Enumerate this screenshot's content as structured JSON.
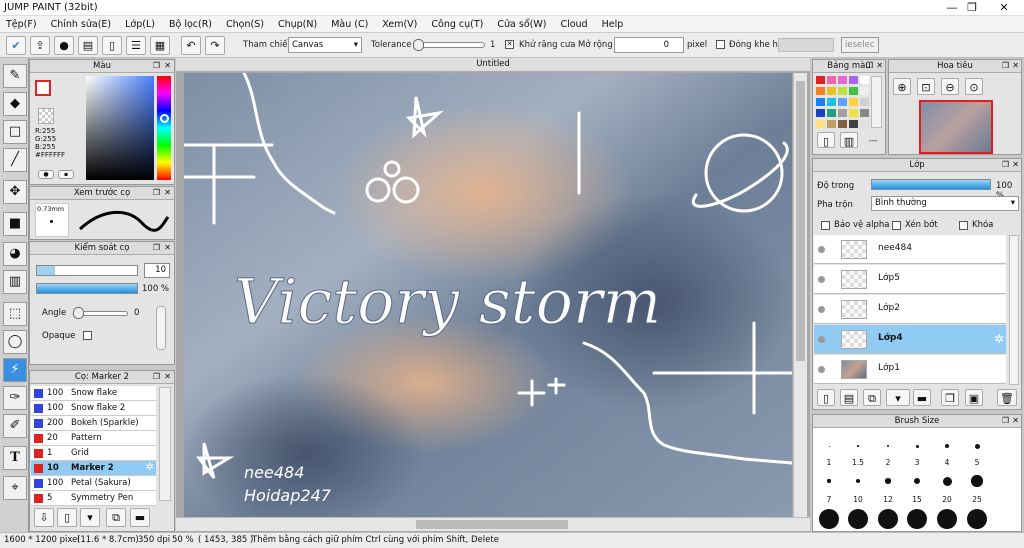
{
  "app": {
    "title": "JUMP PAINT (32bit)"
  },
  "window_controls": {
    "min": "—",
    "max": "❐",
    "close": "✕"
  },
  "menu": [
    "Tệp(F)",
    "Chỉnh sửa(E)",
    "Lớp(L)",
    "Bộ lọc(R)",
    "Chọn(S)",
    "Chụp(N)",
    "Màu (C)",
    "Xem(V)",
    "Công cụ(T)",
    "Cửa sổ(W)",
    "Cloud",
    "Help"
  ],
  "toolbar": {
    "ref_label": "Tham chiếu",
    "ref_value": "Canvas",
    "tolerance_label": "Tolerance",
    "tolerance_value": "1",
    "antialias_label": "Khử răng cưa",
    "expand_label": "Mở rộng",
    "expand_value": "0",
    "pixel_label": "pixel",
    "close_gap_label": "Đóng khe hở",
    "deselect_label": "ieselec"
  },
  "color_panel": {
    "title": "Màu",
    "rgb": "R:255\nG:255\nB:255\n#FFFFFF"
  },
  "brush_preview": {
    "title": "Xem trước cọ",
    "size": "0.73mm"
  },
  "brush_control": {
    "title": "Kiểm soát cọ",
    "size_value": "10",
    "opacity_value": "100 %",
    "angle_label": "Angle",
    "angle_value": "0",
    "opaque_label": "Opaque"
  },
  "brush_list": {
    "title": "Cọ: Marker 2",
    "items": [
      {
        "n": "100",
        "name": "Snow flake",
        "color": "#3344dd"
      },
      {
        "n": "100",
        "name": "Snow flake 2",
        "color": "#3344dd"
      },
      {
        "n": "200",
        "name": "Bokeh (Sparkle)",
        "color": "#3344dd"
      },
      {
        "n": "20",
        "name": "Pattern",
        "color": "#dd2222"
      },
      {
        "n": "1",
        "name": "Grid",
        "color": "#dd2222"
      },
      {
        "n": "10",
        "name": "Marker 2",
        "color": "#dd2222"
      },
      {
        "n": "100",
        "name": "Petal (Sakura)",
        "color": "#3344dd"
      },
      {
        "n": "5",
        "name": "Symmetry Pen",
        "color": "#dd2222"
      }
    ]
  },
  "canvas": {
    "tab": "Untitled",
    "artwork_title": "Victory storm",
    "credit1": "nee484",
    "credit2": "Hoidap247"
  },
  "palette": {
    "title": "Bảng màu",
    "colors": [
      "#e02020",
      "#ee66aa",
      "#e06ad0",
      "#aa66ee",
      "#ffffff",
      "#f08020",
      "#f0c020",
      "#c0e040",
      "#40c040",
      "#eeeeee",
      "#2080f0",
      "#20c0e0",
      "#60a0ff",
      "#ffd040",
      "#d0d0d0",
      "#1a40c0",
      "#20a080",
      "#a0a0a0",
      "#f0e040",
      "#888888",
      "#ffe080",
      "#c0a060",
      "#806040",
      "#404040",
      "#e0e0e0"
    ]
  },
  "navigator": {
    "title": "Hoa tiêu"
  },
  "layers": {
    "title": "Lớp",
    "opacity_label": "Độ trong",
    "opacity_value": "100 %",
    "blend_label": "Pha trộn",
    "blend_value": "Bình thường",
    "protect_alpha": "Bảo vệ alpha",
    "clip": "Xén bớt",
    "lock": "Khóa",
    "items": [
      {
        "name": "nee484",
        "active": false,
        "photo": false
      },
      {
        "name": "Lớp5",
        "active": false,
        "photo": false
      },
      {
        "name": "Lớp2",
        "active": false,
        "photo": false
      },
      {
        "name": "Lớp4",
        "active": true,
        "photo": false
      },
      {
        "name": "Lớp1",
        "active": false,
        "photo": true
      }
    ]
  },
  "brush_size": {
    "title": "Brush Size",
    "row1": [
      "1",
      "1.5",
      "2",
      "3",
      "4",
      "5"
    ],
    "row2": [
      "7",
      "10",
      "12",
      "15",
      "20",
      "25"
    ]
  },
  "status": {
    "dims": "1600 * 1200 pixel",
    "cm": "(11.6 * 8.7cm)",
    "dpi": "350 dpi",
    "zoom": "50 %",
    "coords": "( 1453, 385 )",
    "hint": "Thêm bằng cách giữ phím Ctrl cùng với phím Shift, Delete"
  }
}
